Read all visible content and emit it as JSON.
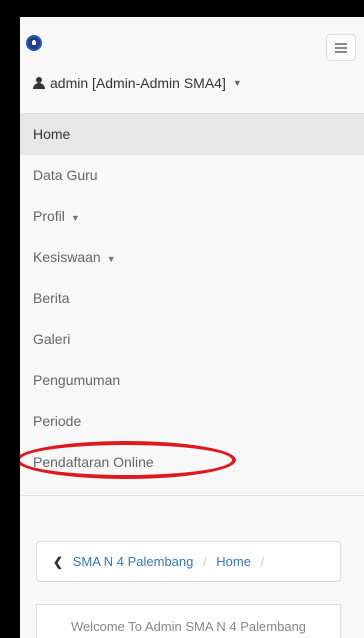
{
  "user_menu": {
    "label": "admin [Admin-Admin SMA4]"
  },
  "nav": {
    "items": [
      {
        "label": "Home"
      },
      {
        "label": "Data Guru"
      },
      {
        "label": "Profil"
      },
      {
        "label": "Kesiswaan"
      },
      {
        "label": "Berita"
      },
      {
        "label": "Galeri"
      },
      {
        "label": "Pengumuman"
      },
      {
        "label": "Periode"
      },
      {
        "label": "Pendaftaran Online"
      }
    ]
  },
  "breadcrumb": {
    "school": "SMA N 4 Palembang",
    "home": "Home",
    "separator": "/"
  },
  "welcome": {
    "text": "Welcome To Admin SMA N 4 Palembang"
  },
  "colors": {
    "highlight": "#e0191f",
    "link": "#337ab7",
    "active_bg": "#e7e7e7"
  },
  "icons": {
    "brand": "school-logo-icon",
    "toggle": "hamburger-menu-icon",
    "user": "user-icon"
  }
}
